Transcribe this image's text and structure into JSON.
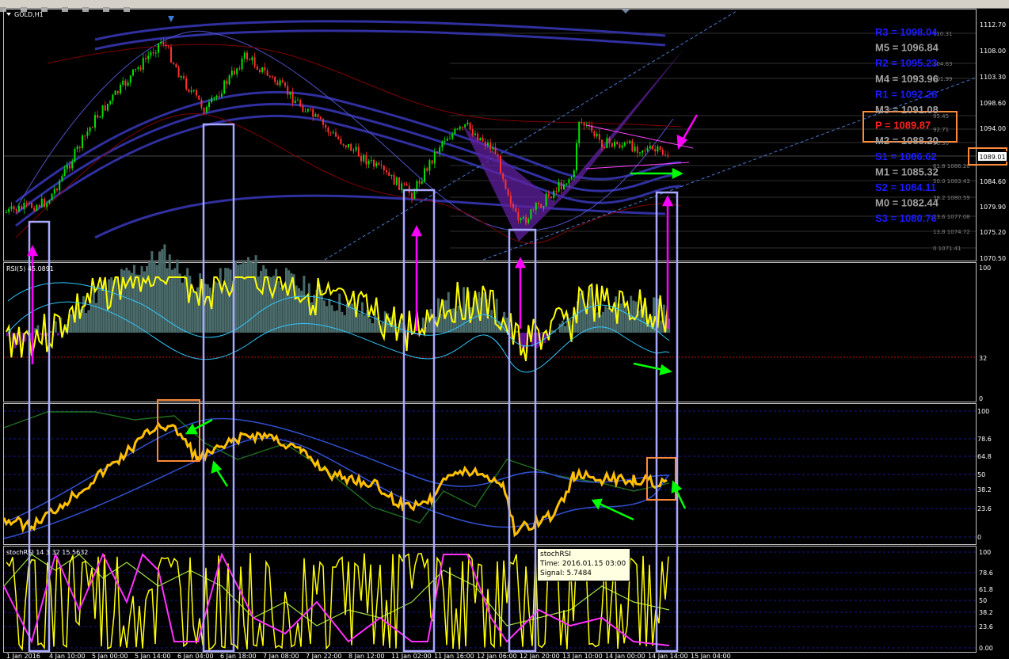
{
  "window": {
    "title": "GOLD,H1"
  },
  "panels": {
    "main": {
      "price_axis": [
        "1112.70",
        "1108.00",
        "1103.30",
        "1098.60",
        "1094.00",
        "1089.01",
        "1084.60",
        "1079.90",
        "1075.20",
        "1070.50"
      ],
      "current_price": "1089.01",
      "fib_levels": [
        "110.31",
        "104.63",
        "101.99",
        "95.45",
        "92.71",
        "90.30",
        "1086.20",
        "1083.43",
        "1080.59",
        "1077.08",
        "1074.72",
        "0 1071.41"
      ],
      "fib_prefix": [
        "",
        "",
        "",
        "",
        "",
        "",
        "61.8",
        "50.0",
        "38.2",
        "23.6",
        "13.8",
        ""
      ],
      "pivots": [
        {
          "label": "R3 = 1098.04",
          "color": "#1a1aff"
        },
        {
          "label": "M5 = 1096.84",
          "color": "#a0a0a0"
        },
        {
          "label": "R2 = 1095.23",
          "color": "#1a1aff"
        },
        {
          "label": "M4 = 1093.96",
          "color": "#a0a0a0"
        },
        {
          "label": "R1 = 1092.28",
          "color": "#1a1aff"
        },
        {
          "label": "M3 = 1091.08",
          "color": "#a0a0a0"
        },
        {
          "label": "P  = 1089.87",
          "color": "#ff2020"
        },
        {
          "label": "M2 = 1088.20",
          "color": "#a0a0a0"
        },
        {
          "label": "S1 = 1086.62",
          "color": "#1a1aff"
        },
        {
          "label": "M1 = 1085.32",
          "color": "#a0a0a0"
        },
        {
          "label": "S2 = 1084.11",
          "color": "#1a1aff"
        },
        {
          "label": "M0 = 1082.44",
          "color": "#a0a0a0"
        },
        {
          "label": "S3 = 1080.76",
          "color": "#1a1aff"
        }
      ]
    },
    "rsi": {
      "label": "RSI(5) 45.0891",
      "axis": [
        "100",
        "32",
        "0"
      ]
    },
    "third": {
      "axis": [
        "100",
        "78.6",
        "64.8",
        "50",
        "38.2",
        "23.6",
        "0"
      ]
    },
    "stoch": {
      "label": "stochRSI 14 3 32 15.5632",
      "axis": [
        "100",
        "78.6",
        "61.8",
        "50",
        "38.2",
        "23.6",
        "0.00"
      ]
    }
  },
  "tooltip": {
    "title": "stochRSI",
    "time": "Time: 2016.01.15 03:00",
    "signal": "Signal: 5.7484"
  },
  "time_axis": [
    "1 Jan 2016",
    "4 Jan 10:00",
    "5 Jan 00:00",
    "5 Jan 14:00",
    "6 Jan 04:00",
    "6 Jan 18:00",
    "7 Jan 08:00",
    "7 Jan 22:00",
    "8 Jan 12:00",
    "11 Jan 02:00",
    "11 Jan 16:00",
    "12 Jan 06:00",
    "12 Jan 20:00",
    "13 Jan 10:00",
    "14 Jan 00:00",
    "14 Jan 14:00",
    "15 Jan 04:00"
  ],
  "colors": {
    "bull": "#00e000",
    "bear": "#ff3030",
    "rsi": "#ffff00",
    "highlight_box": "#a8a8ff",
    "orange_box": "#ff8a3a",
    "magenta": "#ff00ff",
    "green_arrow": "#00ff00"
  }
}
